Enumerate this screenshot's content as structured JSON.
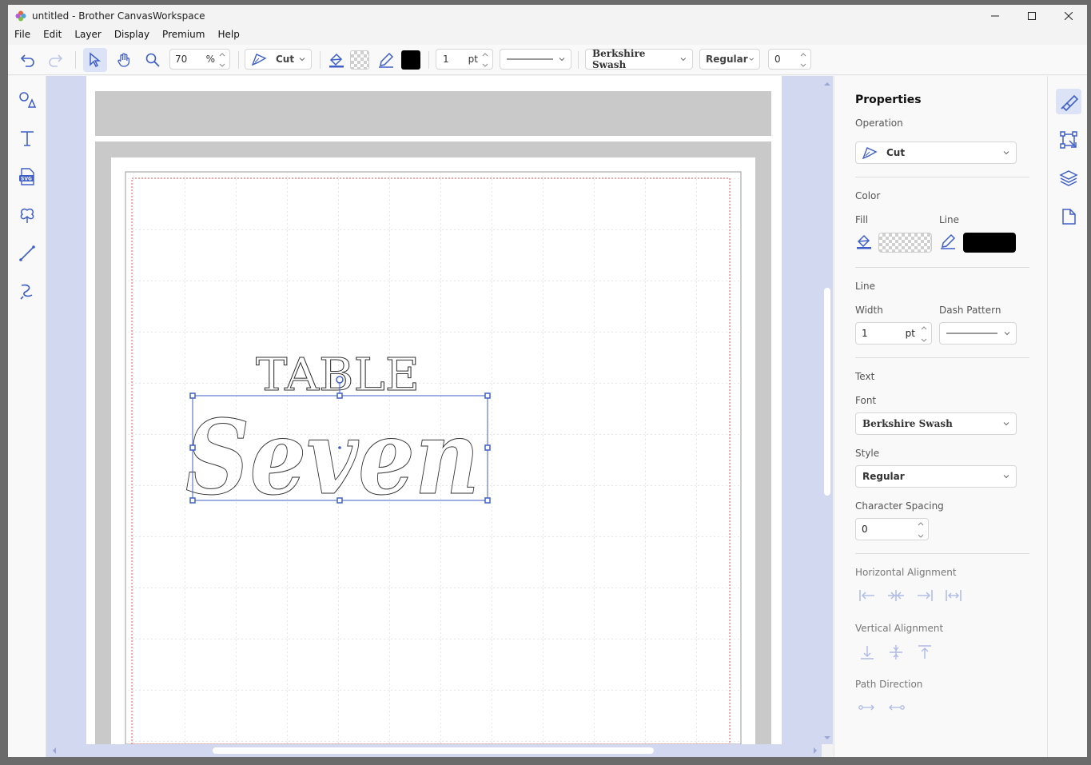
{
  "window": {
    "title": "untitled - Brother CanvasWorkspace"
  },
  "menu": {
    "items": [
      "File",
      "Edit",
      "Layer",
      "Display",
      "Premium",
      "Help"
    ]
  },
  "toolbar": {
    "zoom_value": "70",
    "zoom_unit": "%",
    "operation": "Cut",
    "line_width": "1",
    "line_width_unit": "pt",
    "font": "Berkshire Swash",
    "style": "Regular",
    "spacing": "0",
    "line_color": "#000000"
  },
  "canvas": {
    "text_top": "TABLE",
    "text_main": "Seven"
  },
  "properties": {
    "title": "Properties",
    "operation_label": "Operation",
    "operation_value": "Cut",
    "color_label": "Color",
    "fill_label": "Fill",
    "line_color_label": "Line",
    "line_section_label": "Line",
    "width_label": "Width",
    "width_value": "1",
    "width_unit": "pt",
    "dash_label": "Dash Pattern",
    "text_section_label": "Text",
    "font_label": "Font",
    "font_value": "Berkshire Swash",
    "style_label": "Style",
    "style_value": "Regular",
    "char_spacing_label": "Character Spacing",
    "char_spacing_value": "0",
    "h_align_label": "Horizontal Alignment",
    "v_align_label": "Vertical Alignment",
    "path_dir_label": "Path Direction"
  },
  "colors": {
    "accent": "#3f5fc8",
    "canvas_bg": "#d2d8ef",
    "cut_margin": "#e05050"
  }
}
